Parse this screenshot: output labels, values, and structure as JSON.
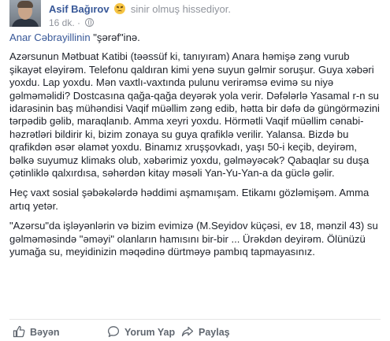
{
  "post": {
    "author": "Asif Bağırov",
    "feeling": "sinir olmuş hissediyor.",
    "time": "16 dk.",
    "dot": "·",
    "privacy_icon": "globe-icon",
    "mention_name": "Anar Cəbrayillinin",
    "mention_rest": " \"şərəf\"inə.",
    "paragraphs": [
      "Azərsunun Mətbuat Katibi (təəssüf ki, tanıyıram) Anara həmişə zəng vurub şikayət eləyirəm. Telefonu qaldıran kimi yenə suyun gəlmir soruşur. Guya xəbəri yoxdu. Lap yoxdu. Mən vaxtlı-vaxtında pulunu verirəmsə evimə su niyə gəlməməlidi? Dostcasına qağa-qağa deyərək yola verir. Dəfələrlə Yasamal r-n su idarəsinin baş mühəndisi Vaqif müəllim zəng edib, hətta bir dəfə də güngörməzini tərpədib gəlib, maraqlanıb. Amma xeyri yoxdu. Hörmətli Vaqif müəllim cənabi-həzrətləri bildirir ki, bizim zonaya su guya qrafiklə verilir. Yalansa. Bizdə bu qrafikdən əsər əlamət yoxdu. Binamız xruşşovkadı, yaşı 50-i keçib, deyirəm, bəlkə suyumuz klimaks olub, xəbərimiz yoxdu, gəlməyəcək? Qabaqlar su duşa çətinliklə qalxırdısa, səhərdən kitay məsəli Yan-Yu-Yan-a da güclə gəlir.",
      "Heç vaxt sosial şəbəkələrdə həddimi aşmamışam. Etikamı gözləmişəm. Amma artıq yetər.",
      "\"Azərsu\"da işləyənlərin və bizim evimizə (M.Seyidov küçəsi, ev 18, mənzil 43) su gəlməməsində \"əməyi\" olanların hamısını bir-bir ... Ürəkdən deyirəm. Ölünüzü yumağa su, meyidinizin məqədinə dürtməyə pambıq tapmayasınız."
    ]
  },
  "actions": {
    "like": "Bəyən",
    "comment": "Yorum Yap",
    "share": "Paylaş"
  },
  "colors": {
    "link": "#385898",
    "text": "#1d2129",
    "muted": "#90949c",
    "action": "#606770"
  }
}
